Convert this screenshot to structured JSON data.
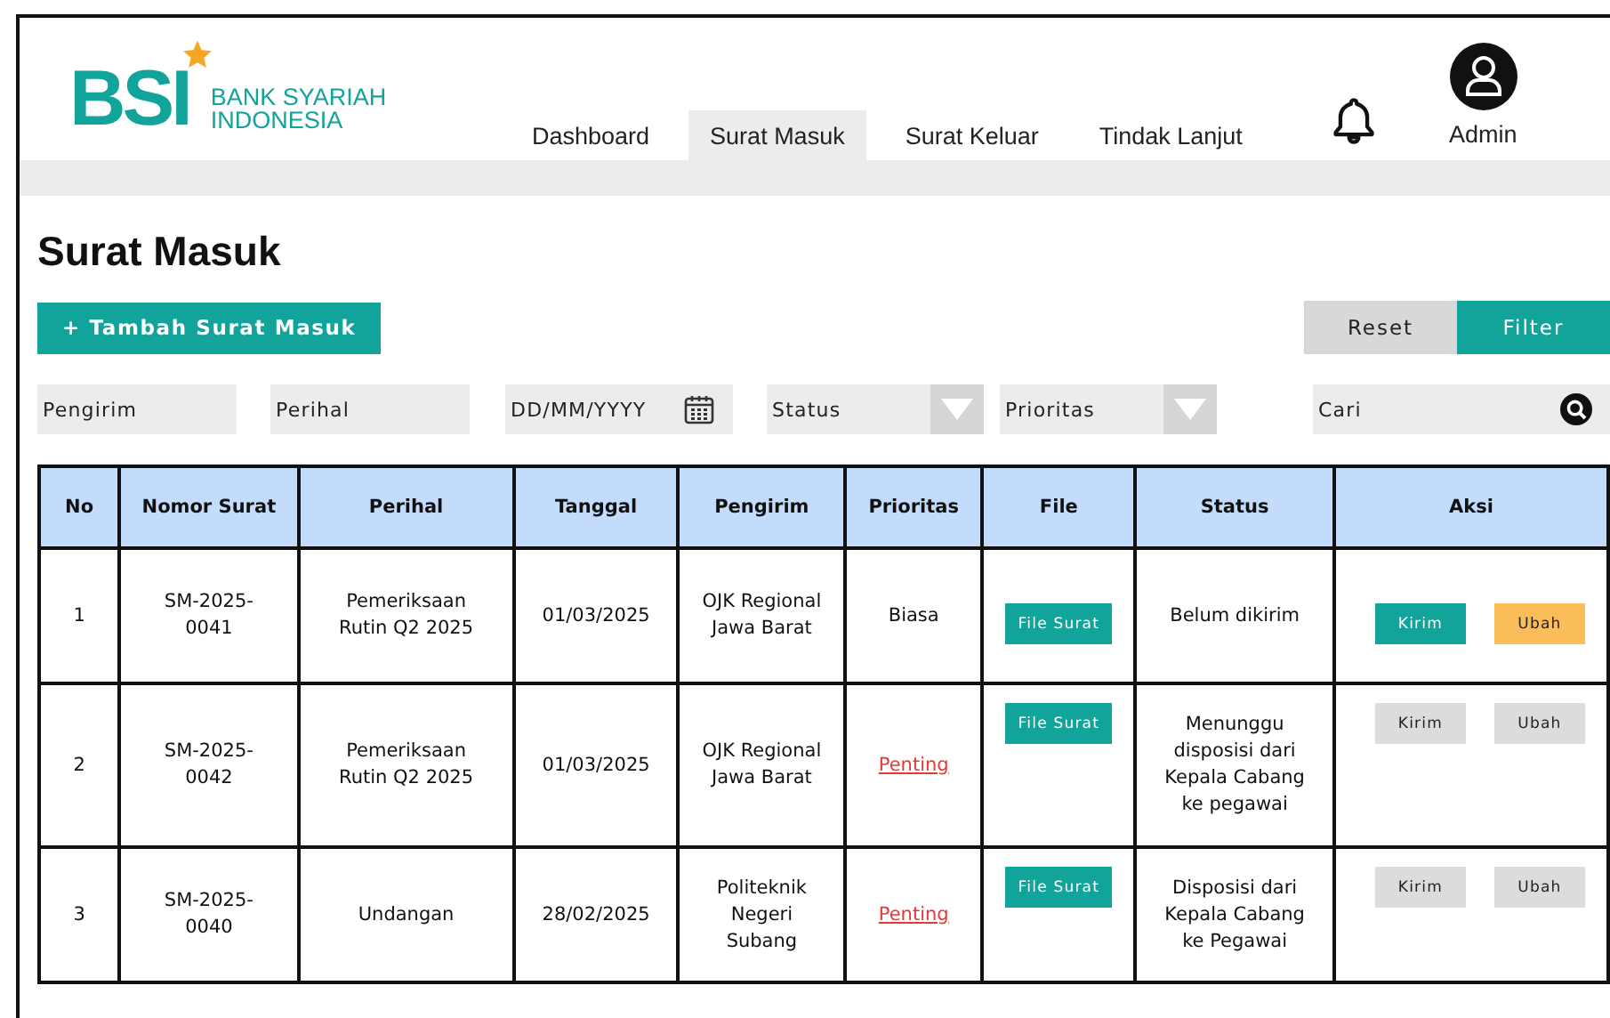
{
  "logo": {
    "mark": "BSI",
    "name_lines": [
      "BANK SYARIAH",
      "INDONESIA"
    ]
  },
  "nav": [
    {
      "label": "Dashboard",
      "selected": false
    },
    {
      "label": "Surat Masuk",
      "selected": true
    },
    {
      "label": "Surat Keluar",
      "selected": false
    },
    {
      "label": "Tindak Lanjut",
      "selected": false
    }
  ],
  "user": {
    "name": "Admin"
  },
  "page_title": "Surat Masuk",
  "add_button": "+ Tambah Surat Masuk",
  "filter_buttons": {
    "reset": "Reset",
    "filter": "Filter"
  },
  "filters": [
    {
      "kind": "text",
      "placeholder": "Pengirim"
    },
    {
      "kind": "text",
      "placeholder": "Perihal"
    },
    {
      "kind": "date",
      "placeholder": "DD/MM/YYYY"
    },
    {
      "kind": "select",
      "placeholder": "Status"
    },
    {
      "kind": "select",
      "placeholder": "Prioritas"
    }
  ],
  "search": {
    "placeholder": "Cari"
  },
  "table": {
    "columns": [
      "No",
      "Nomor Surat",
      "Perihal",
      "Tanggal",
      "Pengirim",
      "Prioritas",
      "File",
      "Status",
      "Aksi"
    ],
    "rows": [
      {
        "no": "1",
        "nomor": "SM-2025-0041",
        "perihal": "Pemeriksaan Rutin Q2 2025",
        "tanggal": "01/03/2025",
        "pengirim": "OJK Regional Jawa Barat",
        "prioritas": "Biasa",
        "urgent": false,
        "file": "File Surat",
        "status": "Belum dikirim",
        "actions_disabled": false,
        "send": "Kirim",
        "edit": "Ubah"
      },
      {
        "no": "2",
        "nomor": "SM-2025-0042",
        "perihal": "Pemeriksaan Rutin Q2 2025",
        "tanggal": "01/03/2025",
        "pengirim": "OJK Regional Jawa Barat",
        "prioritas": "Penting",
        "urgent": true,
        "file": "File Surat",
        "status": "Menunggu disposisi dari Kepala Cabang ke pegawai",
        "actions_disabled": true,
        "send": "Kirim",
        "edit": "Ubah"
      },
      {
        "no": "3",
        "nomor": "SM-2025-0040",
        "perihal": "Undangan",
        "tanggal": "28/02/2025",
        "pengirim": "Politeknik Negeri Subang",
        "prioritas": "Penting",
        "urgent": true,
        "file": "File Surat",
        "status": "Disposisi dari Kepala Cabang ke Pegawai",
        "actions_disabled": true,
        "send": "Kirim",
        "edit": "Ubah"
      }
    ]
  }
}
